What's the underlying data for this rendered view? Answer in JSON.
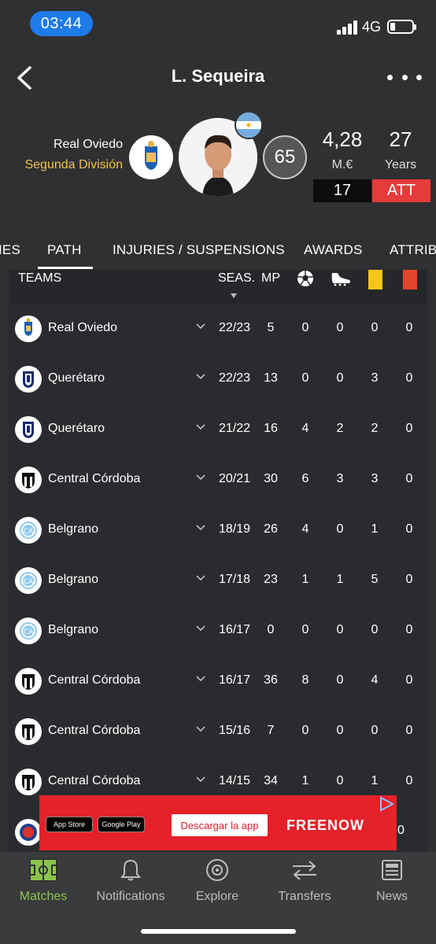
{
  "status_bar": {
    "time": "03:44",
    "network": "4G"
  },
  "header": {
    "title": "L. Sequeira"
  },
  "player": {
    "team": "Real Oviedo",
    "league": "Segunda División",
    "rating": "65",
    "market_value": "4,28",
    "market_value_unit": "M.€",
    "age": "27",
    "age_unit": "Years",
    "shirt_number": "17",
    "position": "ATT"
  },
  "tabs": [
    {
      "label": "IES"
    },
    {
      "label": "PATH",
      "active": true
    },
    {
      "label": "INJURIES / SUSPENSIONS"
    },
    {
      "label": "AWARDS"
    },
    {
      "label": "ATTRIB"
    }
  ],
  "table": {
    "headers": {
      "teams": "TEAMS",
      "season": "SEAS.",
      "mp": "MP"
    },
    "rows": [
      {
        "club": "Real Oviedo",
        "logo": "oviedo",
        "season": "22/23",
        "mp": "5",
        "goals": "0",
        "assists": "0",
        "yellow": "0",
        "red": "0"
      },
      {
        "club": "Querétaro",
        "logo": "queretaro",
        "season": "22/23",
        "mp": "13",
        "goals": "0",
        "assists": "0",
        "yellow": "3",
        "red": "0"
      },
      {
        "club": "Querétaro",
        "logo": "queretaro",
        "season": "21/22",
        "mp": "16",
        "goals": "4",
        "assists": "2",
        "yellow": "2",
        "red": "0"
      },
      {
        "club": "Central Córdoba",
        "logo": "central",
        "season": "20/21",
        "mp": "30",
        "goals": "6",
        "assists": "3",
        "yellow": "3",
        "red": "0"
      },
      {
        "club": "Belgrano",
        "logo": "belgrano",
        "season": "18/19",
        "mp": "26",
        "goals": "4",
        "assists": "0",
        "yellow": "1",
        "red": "0"
      },
      {
        "club": "Belgrano",
        "logo": "belgrano",
        "season": "17/18",
        "mp": "23",
        "goals": "1",
        "assists": "1",
        "yellow": "5",
        "red": "0"
      },
      {
        "club": "Belgrano",
        "logo": "belgrano",
        "season": "16/17",
        "mp": "0",
        "goals": "0",
        "assists": "0",
        "yellow": "0",
        "red": "0"
      },
      {
        "club": "Central Córdoba",
        "logo": "central",
        "season": "16/17",
        "mp": "36",
        "goals": "8",
        "assists": "0",
        "yellow": "4",
        "red": "0"
      },
      {
        "club": "Central Córdoba",
        "logo": "central",
        "season": "15/16",
        "mp": "7",
        "goals": "0",
        "assists": "0",
        "yellow": "0",
        "red": "0"
      },
      {
        "club": "Central Córdoba",
        "logo": "central",
        "season": "14/15",
        "mp": "34",
        "goals": "1",
        "assists": "0",
        "yellow": "1",
        "red": "0"
      }
    ],
    "partial_row_value": "0"
  },
  "ad": {
    "store_badge_1": "App Store",
    "store_badge_2": "Google Play",
    "cta": "Descargar la app",
    "brand": "FREENOW"
  },
  "bottom_nav": [
    {
      "label": "Matches",
      "icon": "pitch-icon",
      "active": true
    },
    {
      "label": "Notifications",
      "icon": "bell-icon"
    },
    {
      "label": "Explore",
      "icon": "compass-icon"
    },
    {
      "label": "Transfers",
      "icon": "transfer-arrows-icon"
    },
    {
      "label": "News",
      "icon": "newspaper-icon"
    }
  ],
  "colors": {
    "background": "#2f3032",
    "accent_gold": "#f2c14e",
    "position_red": "#e63b3b",
    "active_green": "#8bc34a",
    "ad_red": "#e5212a"
  }
}
